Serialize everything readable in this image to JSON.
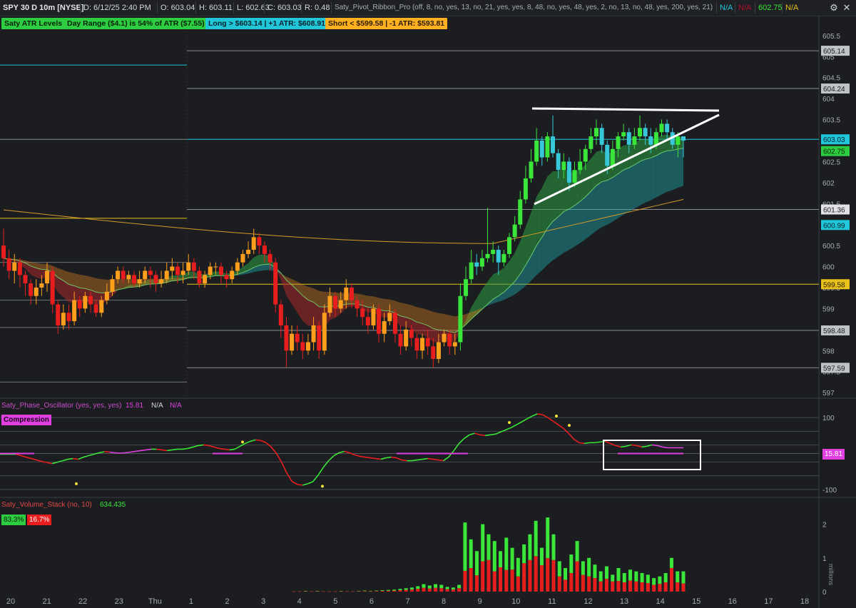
{
  "header": {
    "symbol": "SPY 30 D 10m [NYSE]",
    "date": "D: 6/12/25 2:40 PM",
    "open": "O: 603.04",
    "high": "H: 603.11",
    "low": "L: 602.63",
    "close": "C: 603.03",
    "range": "R: 0.48",
    "study": "Saty_Pivot_Ribbon_Pro (off, 8, no, yes, 13, no, 21, yes, yes, 8, 48, no, yes, 48, yes, 2, no, 13, no, 48, yes, 200, yes, 21)",
    "na1": "N/A",
    "na2": "N/A",
    "value": "602.75",
    "na3": "N/A"
  },
  "labels": {
    "atr_levels": "Saty ATR Levels",
    "day_range": "Day Range ($4.1) is 54% of ATR ($7.55)",
    "long": "Long > $603.14 | +1 ATR: $608.91",
    "short": "Short < $599.58 | -1 ATR: $593.81"
  },
  "oscillator": {
    "title": "Saty_Phase_Oscillator (yes, yes, yes)",
    "value": "15.81",
    "na1": "N/A",
    "na2": "N/A",
    "compression": "Compression",
    "badge": "15.81"
  },
  "volume": {
    "title": "Saty_Volume_Stack (no, 10)",
    "value": "634.435",
    "buy_pct": "83.3%",
    "sell_pct": "16.7%",
    "unit": "millions"
  },
  "price_badges": {
    "b1": "605.14",
    "b2": "604.24",
    "b3": "603.03",
    "b4": "602.75",
    "b5": "601.36",
    "b6": "600.99",
    "b7": "599.58",
    "b8": "598.48",
    "b9": "597.59"
  },
  "colors": {
    "up": "#39e639",
    "down": "#e81e1e",
    "orange": "#ff9f1c",
    "cyan": "#21c6d8",
    "magenta": "#e040e0",
    "yellow": "#e8c21a",
    "background": "#1b1d21"
  },
  "chart_data": {
    "type": "candlestick",
    "price_axis": {
      "ticks": [
        "605.5",
        "605",
        "604.5",
        "604",
        "603.5",
        "603",
        "602.5",
        "602",
        "601.5",
        "601",
        "600.5",
        "600",
        "599.5",
        "599",
        "598.5",
        "598",
        "597.5",
        "597"
      ],
      "range": [
        596.9,
        605.6
      ]
    },
    "time_axis": {
      "ticks": [
        "20",
        "21",
        "22",
        "23",
        "Thu",
        "1",
        "2",
        "3",
        "4",
        "5",
        "6",
        "7",
        "8",
        "9",
        "10",
        "11",
        "12",
        "13",
        "14",
        "15",
        "16",
        "17",
        "18"
      ]
    },
    "levels": [
      605.14,
      604.24,
      603.03,
      601.36,
      599.58,
      598.48,
      597.59
    ],
    "candles": [
      [
        600.5,
        600.2,
        600.9,
        600.0
      ],
      [
        600.2,
        599.9,
        600.4,
        599.7
      ],
      [
        599.9,
        600.1,
        600.3,
        599.6
      ],
      [
        600.1,
        599.8,
        600.2,
        599.5
      ],
      [
        599.8,
        599.6,
        599.9,
        599.3
      ],
      [
        599.6,
        599.3,
        599.7,
        599.1
      ],
      [
        599.3,
        599.5,
        599.7,
        599.1
      ],
      [
        599.5,
        599.6,
        599.8,
        599.3
      ],
      [
        599.6,
        599.9,
        600.1,
        599.4
      ],
      [
        599.9,
        599.1,
        600.0,
        598.9
      ],
      [
        599.1,
        598.6,
        599.2,
        598.4
      ],
      [
        598.6,
        598.9,
        599.1,
        598.5
      ],
      [
        598.9,
        598.7,
        599.1,
        598.5
      ],
      [
        598.7,
        599.2,
        599.4,
        598.6
      ],
      [
        599.2,
        599.0,
        599.3,
        598.8
      ],
      [
        599.0,
        599.3,
        599.4,
        598.9
      ],
      [
        599.3,
        599.1,
        599.4,
        598.9
      ],
      [
        599.1,
        598.9,
        599.2,
        598.8
      ],
      [
        598.9,
        599.2,
        599.3,
        598.8
      ],
      [
        599.2,
        599.4,
        599.6,
        599.1
      ],
      [
        599.4,
        599.7,
        599.8,
        599.3
      ],
      [
        599.7,
        599.9,
        600.0,
        599.6
      ],
      [
        599.9,
        599.7,
        600.0,
        599.6
      ],
      [
        599.7,
        599.8,
        599.9,
        599.6
      ],
      [
        599.8,
        599.6,
        599.9,
        599.5
      ],
      [
        599.6,
        599.7,
        599.9,
        599.5
      ],
      [
        599.7,
        599.9,
        600.0,
        599.6
      ],
      [
        599.9,
        599.8,
        600.0,
        599.5
      ],
      [
        599.8,
        599.6,
        599.9,
        599.4
      ],
      [
        599.6,
        599.7,
        599.9,
        599.5
      ],
      [
        599.7,
        599.9,
        600.1,
        599.6
      ],
      [
        599.9,
        600.0,
        600.2,
        599.7
      ],
      [
        600.0,
        599.8,
        600.1,
        599.6
      ],
      [
        599.8,
        599.9,
        600.1,
        599.6
      ],
      [
        599.9,
        600.1,
        600.3,
        599.8
      ],
      [
        600.1,
        599.9,
        600.2,
        599.7
      ],
      [
        599.9,
        599.6,
        600.0,
        599.5
      ],
      [
        599.6,
        599.8,
        599.9,
        599.5
      ],
      [
        599.8,
        600.0,
        600.1,
        599.7
      ],
      [
        600.0,
        600.0,
        600.1,
        599.8
      ],
      [
        600.0,
        599.8,
        600.1,
        599.6
      ],
      [
        599.8,
        599.7,
        599.9,
        599.5
      ],
      [
        599.7,
        599.9,
        600.0,
        599.6
      ],
      [
        599.9,
        600.1,
        600.2,
        599.8
      ],
      [
        600.1,
        600.3,
        600.4,
        600.0
      ],
      [
        600.3,
        600.4,
        600.6,
        600.2
      ],
      [
        600.4,
        600.7,
        600.9,
        600.3
      ],
      [
        600.7,
        600.5,
        600.8,
        600.3
      ],
      [
        600.5,
        600.3,
        600.6,
        600.1
      ],
      [
        600.3,
        600.1,
        600.4,
        599.9
      ],
      [
        600.1,
        599.1,
        600.2,
        598.9
      ],
      [
        599.1,
        598.6,
        599.2,
        598.3
      ],
      [
        598.6,
        598.0,
        598.8,
        597.6
      ],
      [
        598.0,
        598.4,
        598.6,
        597.9
      ],
      [
        598.4,
        598.2,
        598.6,
        598.0
      ],
      [
        598.2,
        598.0,
        598.4,
        597.8
      ],
      [
        598.0,
        598.2,
        598.4,
        597.9
      ],
      [
        598.2,
        598.6,
        598.8,
        598.0
      ],
      [
        598.6,
        598.0,
        598.7,
        597.8
      ],
      [
        598.0,
        598.9,
        599.1,
        597.9
      ],
      [
        598.9,
        599.3,
        599.5,
        598.8
      ],
      [
        599.3,
        599.0,
        599.4,
        598.8
      ],
      [
        599.0,
        599.2,
        599.4,
        598.9
      ],
      [
        599.2,
        599.5,
        599.7,
        599.0
      ],
      [
        599.5,
        599.2,
        599.6,
        599.0
      ],
      [
        599.2,
        599.0,
        599.3,
        598.8
      ],
      [
        599.0,
        598.8,
        599.2,
        598.6
      ],
      [
        598.8,
        598.6,
        599.0,
        598.4
      ],
      [
        598.6,
        599.0,
        599.1,
        598.5
      ],
      [
        599.0,
        598.4,
        599.1,
        598.2
      ],
      [
        598.4,
        598.7,
        598.9,
        598.2
      ],
      [
        598.7,
        598.9,
        599.1,
        598.6
      ],
      [
        598.9,
        598.4,
        599.0,
        598.2
      ],
      [
        598.4,
        598.1,
        598.6,
        597.9
      ],
      [
        598.1,
        598.5,
        598.7,
        598.0
      ],
      [
        598.5,
        598.3,
        598.6,
        598.1
      ],
      [
        598.3,
        598.0,
        598.4,
        597.8
      ],
      [
        598.0,
        598.3,
        598.4,
        597.8
      ],
      [
        598.3,
        598.1,
        598.5,
        597.9
      ],
      [
        598.1,
        597.8,
        598.3,
        597.6
      ],
      [
        597.8,
        598.2,
        598.4,
        597.7
      ],
      [
        598.2,
        598.4,
        598.5,
        598.1
      ],
      [
        598.4,
        598.1,
        598.5,
        597.9
      ],
      [
        598.1,
        598.2,
        598.4,
        597.9
      ],
      [
        598.2,
        599.3,
        599.6,
        598.0
      ],
      [
        599.3,
        599.7,
        600.0,
        599.2
      ],
      [
        599.7,
        600.1,
        600.4,
        599.6
      ],
      [
        600.1,
        600.0,
        600.3,
        599.8
      ],
      [
        600.0,
        600.2,
        600.4,
        599.9
      ],
      [
        600.2,
        600.3,
        601.4,
        600.1
      ],
      [
        600.3,
        600.4,
        600.6,
        600.1
      ],
      [
        600.4,
        600.1,
        600.5,
        599.8
      ],
      [
        600.1,
        600.3,
        600.4,
        600.0
      ],
      [
        600.3,
        600.7,
        600.8,
        600.2
      ],
      [
        600.7,
        601.0,
        601.2,
        600.6
      ],
      [
        601.0,
        601.6,
        601.8,
        600.9
      ],
      [
        601.6,
        602.1,
        602.4,
        601.5
      ],
      [
        602.1,
        602.5,
        602.8,
        602.0
      ],
      [
        602.5,
        603.0,
        603.3,
        602.4
      ],
      [
        603.0,
        602.6,
        603.1,
        602.4
      ],
      [
        602.6,
        603.1,
        603.2,
        602.5
      ],
      [
        603.1,
        602.7,
        603.6,
        602.6
      ],
      [
        602.7,
        602.3,
        602.8,
        602.1
      ],
      [
        602.3,
        602.5,
        602.7,
        602.1
      ],
      [
        602.5,
        602.0,
        602.6,
        601.8
      ],
      [
        602.0,
        602.3,
        602.5,
        601.9
      ],
      [
        602.3,
        602.5,
        602.8,
        602.2
      ],
      [
        602.5,
        602.8,
        602.9,
        602.3
      ],
      [
        602.8,
        603.1,
        603.3,
        602.7
      ],
      [
        603.1,
        603.3,
        603.5,
        602.9
      ],
      [
        603.3,
        602.9,
        603.4,
        602.7
      ],
      [
        602.9,
        602.4,
        603.0,
        602.2
      ],
      [
        602.4,
        602.8,
        603.0,
        602.3
      ],
      [
        602.8,
        603.1,
        603.2,
        602.6
      ],
      [
        603.1,
        603.2,
        603.4,
        603.0
      ],
      [
        603.2,
        602.9,
        603.3,
        602.7
      ],
      [
        602.9,
        603.1,
        603.3,
        602.8
      ],
      [
        603.1,
        603.3,
        603.6,
        603.0
      ],
      [
        603.3,
        603.1,
        603.4,
        602.9
      ],
      [
        603.1,
        602.9,
        603.3,
        602.7
      ],
      [
        602.9,
        603.2,
        603.3,
        602.8
      ],
      [
        603.2,
        603.4,
        603.5,
        603.1
      ],
      [
        603.4,
        603.2,
        603.5,
        603.0
      ],
      [
        603.2,
        602.9,
        603.3,
        602.8
      ],
      [
        602.9,
        603.1,
        603.2,
        602.6
      ],
      [
        603.1,
        603.0,
        603.1,
        602.6
      ]
    ],
    "oscillator": {
      "ticks": [
        "100",
        "0",
        "-100"
      ],
      "range": [
        -118,
        118
      ],
      "values": [
        -2,
        -2,
        -2,
        -2,
        -6,
        -10,
        -14,
        -18,
        -22,
        -25,
        -28,
        -24,
        -20,
        -16,
        -14,
        -16,
        -10,
        -6,
        -2,
        2,
        5,
        4,
        2,
        1,
        2,
        4,
        6,
        8,
        10,
        12,
        12,
        10,
        8,
        10,
        12,
        12,
        14,
        18,
        22,
        24,
        22,
        18,
        14,
        12,
        10,
        12,
        20,
        28,
        34,
        38,
        36,
        30,
        18,
        0,
        -25,
        -55,
        -78,
        -86,
        -88,
        -84,
        -78,
        -60,
        -38,
        -20,
        -6,
        2,
        6,
        2,
        -4,
        -8,
        -10,
        -12,
        -14,
        -16,
        -12,
        -10,
        -12,
        -18,
        -20,
        -20,
        -18,
        -16,
        -14,
        -16,
        -18,
        -20,
        -10,
        8,
        28,
        42,
        52,
        56,
        52,
        50,
        52,
        54,
        60,
        66,
        72,
        80,
        88,
        96,
        104,
        110,
        108,
        100,
        90,
        80,
        70,
        56,
        40,
        30,
        28,
        30,
        30,
        32,
        34,
        28,
        22,
        18,
        20,
        24,
        22,
        18,
        20,
        24,
        22,
        18,
        16,
        16,
        16,
        16
      ],
      "compression": [
        [
          -4,
          -14
        ],
        [
          28,
          40
        ],
        [
          54,
          71
        ],
        [
          90,
          96
        ],
        [
          144,
          164
        ]
      ]
    },
    "volume": {
      "ticks": [
        "2",
        "1",
        "0"
      ],
      "range": [
        0,
        2.35
      ],
      "bars": [
        0.01,
        0.01,
        0.02,
        0.01,
        0.02,
        0.01,
        0.01,
        0.01,
        0.02,
        0.01,
        0.01,
        0.02,
        0.03,
        0.02,
        0.03,
        0.04,
        0.05,
        0.06,
        0.08,
        0.1,
        0.12,
        0.16,
        0.22,
        0.18,
        0.22,
        0.2,
        0.14,
        0.12,
        0.2,
        2.05,
        1.55,
        1.2,
        2.0,
        1.7,
        1.5,
        1.2,
        1.6,
        1.3,
        1.0,
        1.4,
        1.7,
        2.1,
        1.3,
        2.2,
        1.7,
        0.9,
        0.7,
        1.1,
        1.5,
        0.9,
        1.0,
        0.8,
        0.6,
        0.75,
        0.5,
        0.7,
        0.55,
        0.65,
        0.6,
        0.55,
        0.5,
        0.4,
        0.45,
        0.55,
        1.0,
        0.6,
        0.6
      ],
      "buy_ratio": [
        0.5,
        0.5,
        0.5,
        0.5,
        0.5,
        0.5,
        0.5,
        0.5,
        0.5,
        0.5,
        0.5,
        0.5,
        0.5,
        0.5,
        0.5,
        0.5,
        0.5,
        0.5,
        0.5,
        0.5,
        0.5,
        0.5,
        0.5,
        0.5,
        0.5,
        0.5,
        0.5,
        0.5,
        0.5,
        0.7,
        0.55,
        0.6,
        0.55,
        0.45,
        0.6,
        0.4,
        0.6,
        0.5,
        0.55,
        0.4,
        0.45,
        0.5,
        0.4,
        0.55,
        0.45,
        0.5,
        0.5,
        0.5,
        0.4,
        0.45,
        0.55,
        0.5,
        0.5,
        0.5,
        0.4,
        0.55,
        0.5,
        0.5,
        0.5,
        0.5,
        0.5,
        0.5,
        0.5,
        0.5,
        0.3,
        0.55,
        0.6
      ]
    }
  }
}
